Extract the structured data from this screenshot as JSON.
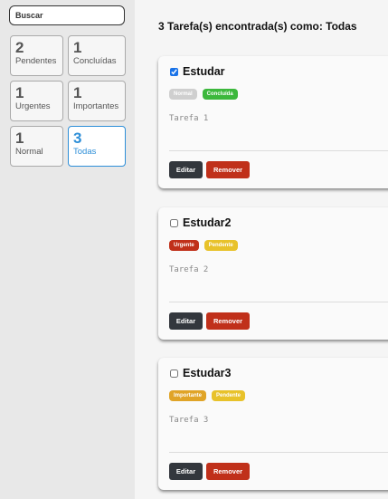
{
  "search": {
    "placeholder": "Buscar",
    "value": ""
  },
  "filters": [
    {
      "count": "2",
      "label": "Pendentes",
      "active": false
    },
    {
      "count": "1",
      "label": "Concluídas",
      "active": false
    },
    {
      "count": "1",
      "label": "Urgentes",
      "active": false
    },
    {
      "count": "1",
      "label": "Importantes",
      "active": false
    },
    {
      "count": "1",
      "label": "Normal",
      "active": false
    },
    {
      "count": "3",
      "label": "Todas",
      "active": true
    }
  ],
  "heading": "3 Tarefa(s) encontrada(s) como: Todas",
  "tasks": [
    {
      "title": "Estudar",
      "checked": true,
      "description": "Tarefa 1",
      "priority": {
        "label": "Normal",
        "color": "#cfcfcf"
      },
      "status": {
        "label": "Concluída",
        "color": "#3cb83c"
      }
    },
    {
      "title": "Estudar2",
      "checked": false,
      "description": "Tarefa 2",
      "priority": {
        "label": "Urgente",
        "color": "#c0301a"
      },
      "status": {
        "label": "Pendente",
        "color": "#e8c22a"
      }
    },
    {
      "title": "Estudar3",
      "checked": false,
      "description": "Tarefa 3",
      "priority": {
        "label": "Importante",
        "color": "#e0a427"
      },
      "status": {
        "label": "Pendente",
        "color": "#e8c22a"
      }
    }
  ],
  "buttons": {
    "edit": "Editar",
    "remove": "Remover"
  },
  "colors": {
    "accent": "#2e8fd8",
    "edit_button": "#33373d",
    "remove_button": "#c0301a"
  }
}
